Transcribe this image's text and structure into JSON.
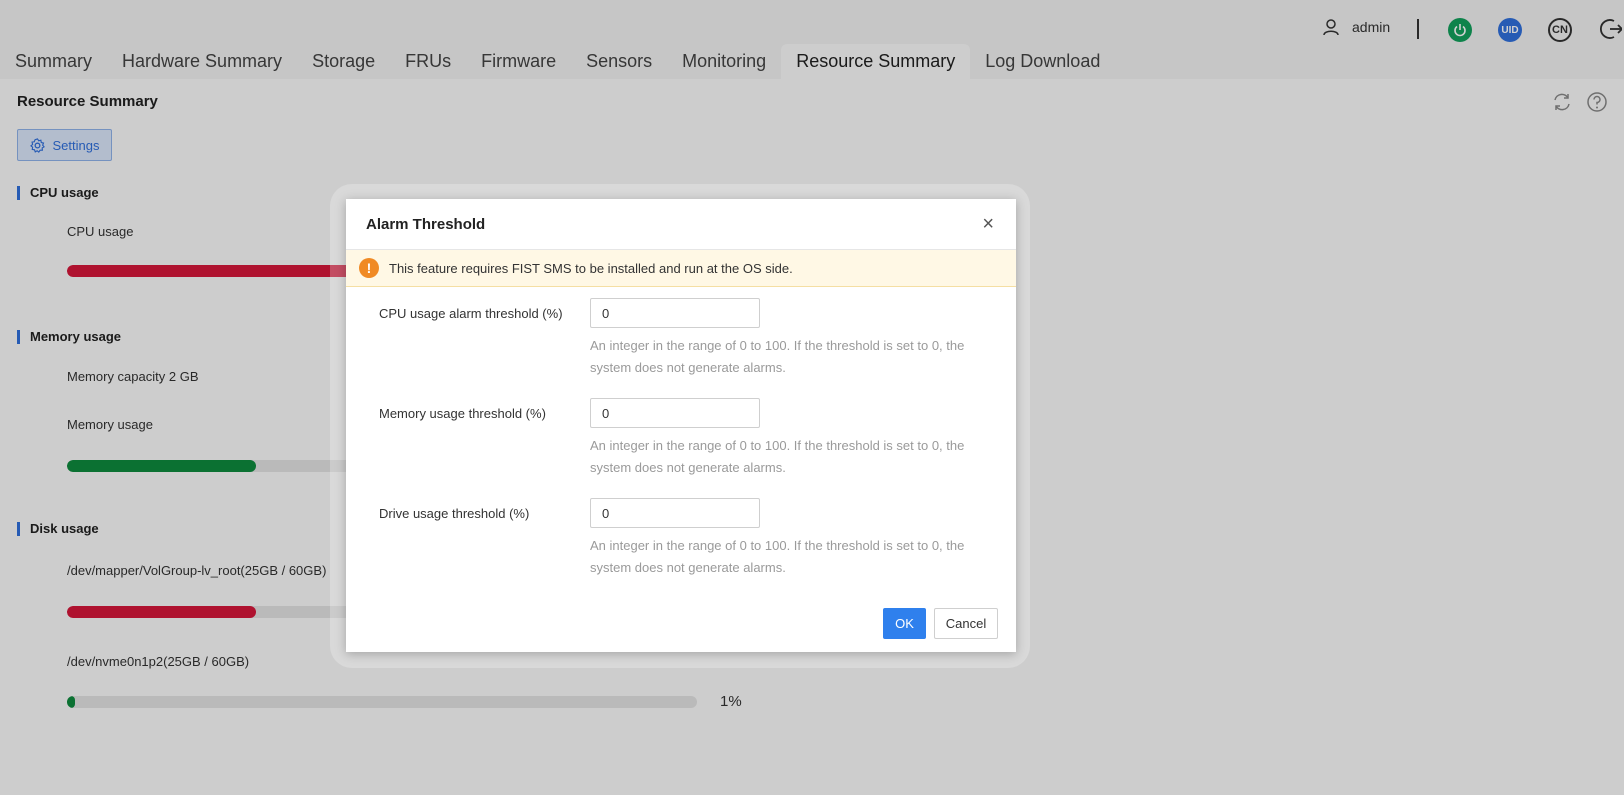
{
  "header": {
    "username": "admin",
    "uid_badge": "UID",
    "language_badge": "CN",
    "icons": [
      "user-icon",
      "power-icon",
      "uid-icon",
      "language-icon",
      "logout-icon"
    ]
  },
  "tabs": [
    {
      "label": "Summary",
      "active": false
    },
    {
      "label": "Hardware Summary",
      "active": false
    },
    {
      "label": "Storage",
      "active": false
    },
    {
      "label": "FRUs",
      "active": false
    },
    {
      "label": "Firmware",
      "active": false
    },
    {
      "label": "Sensors",
      "active": false
    },
    {
      "label": "Monitoring",
      "active": false
    },
    {
      "label": "Resource Summary",
      "active": true
    },
    {
      "label": "Log Download",
      "active": false
    }
  ],
  "page": {
    "title": "Resource Summary",
    "settings_label": "Settings"
  },
  "cpu": {
    "section_title": "CPU usage",
    "label": "CPU usage",
    "color": "#d6163a"
  },
  "memory": {
    "section_title": "Memory usage",
    "capacity": "Memory capacity 2 GB",
    "label": "Memory usage",
    "color": "#0e8a3e"
  },
  "disk": {
    "section_title": "Disk usage",
    "items": [
      {
        "label": "/dev/mapper/VolGroup-lv_root(25GB / 60GB)",
        "color": "#d6163a"
      },
      {
        "label": "/dev/nvme0n1p2(25GB / 60GB)",
        "percent": "1%",
        "fill_fraction": 0.01,
        "color": "#0e8a3e"
      }
    ]
  },
  "modal": {
    "title": "Alarm Threshold",
    "close": "×",
    "notice": "This feature requires FIST SMS to be installed and run at the OS side.",
    "fields": [
      {
        "label": "CPU usage alarm threshold (%)",
        "value": "0",
        "hint": "An integer in the range of 0 to 100. If the threshold is set to 0, the system does not generate alarms."
      },
      {
        "label": "Memory usage threshold (%)",
        "value": "0",
        "hint": "An integer in the range of 0 to 100. If the threshold is set to 0, the system does not generate alarms."
      },
      {
        "label": "Drive usage threshold (%)",
        "value": "0",
        "hint": "An integer in the range of 0 to 100. If the threshold is set to 0, the system does not generate alarms."
      }
    ],
    "ok_label": "OK",
    "cancel_label": "Cancel"
  },
  "colors": {
    "accent": "#2f6fdc",
    "ok_button": "#2f80ed",
    "power": "#12a05c",
    "warning": "#f08a24"
  }
}
